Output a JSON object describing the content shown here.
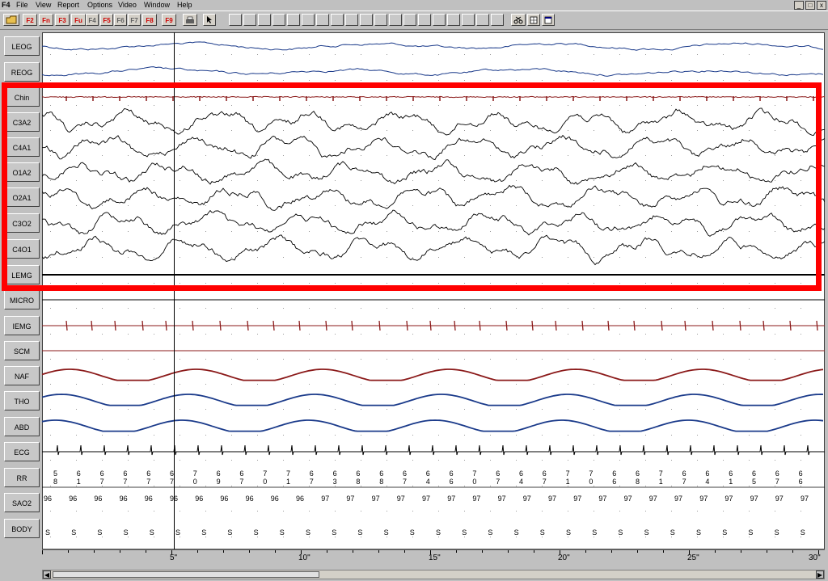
{
  "app": {
    "title": "F4"
  },
  "menu": [
    "File",
    "View",
    "Report",
    "Options",
    "Video",
    "Window",
    "Help"
  ],
  "window_controls": [
    "_",
    "□",
    "x"
  ],
  "toolbar": {
    "function_keys": [
      {
        "label": "F2",
        "color": "red"
      },
      {
        "label": "Fn",
        "color": "red"
      },
      {
        "label": "F3",
        "color": "red"
      },
      {
        "label": "Fu",
        "color": "red"
      },
      {
        "label": "F4",
        "color": "gray"
      },
      {
        "label": "F5",
        "color": "red"
      },
      {
        "label": "F6",
        "color": "gray"
      },
      {
        "label": "F7",
        "color": "gray"
      },
      {
        "label": "F8",
        "color": "red"
      },
      {
        "label": "F9",
        "color": "red"
      }
    ]
  },
  "channels": [
    {
      "name": "LEOG",
      "color": "#1a3a8a",
      "type": "eog"
    },
    {
      "name": "REOG",
      "color": "#1a3a8a",
      "type": "eog"
    },
    {
      "name": "Chin",
      "color": "#8b1a1a",
      "type": "chin"
    },
    {
      "name": "C3A2",
      "color": "#000000",
      "type": "eeg"
    },
    {
      "name": "C4A1",
      "color": "#000000",
      "type": "eeg"
    },
    {
      "name": "O1A2",
      "color": "#000000",
      "type": "eeg"
    },
    {
      "name": "O2A1",
      "color": "#000000",
      "type": "eeg"
    },
    {
      "name": "C3O2",
      "color": "#000000",
      "type": "eeg"
    },
    {
      "name": "C4O1",
      "color": "#000000",
      "type": "eeg"
    },
    {
      "name": "LEMG",
      "color": "#000000",
      "type": "flat"
    },
    {
      "name": "MICRO",
      "color": "#000000",
      "type": "flat"
    },
    {
      "name": "IEMG",
      "color": "#8b1a1a",
      "type": "spikes"
    },
    {
      "name": "SCM",
      "color": "#8b1a1a",
      "type": "flat"
    },
    {
      "name": "NAF",
      "color": "#8b1a1a",
      "type": "resp"
    },
    {
      "name": "THO",
      "color": "#1a3a8a",
      "type": "resp"
    },
    {
      "name": "ABD",
      "color": "#1a3a8a",
      "type": "resp"
    },
    {
      "name": "ECG",
      "color": "#000000",
      "type": "ecg"
    },
    {
      "name": "RR",
      "color": "#000000",
      "type": "numbers"
    },
    {
      "name": "SAO2",
      "color": "#000000",
      "type": "numbers"
    },
    {
      "name": "BODY",
      "color": "#000000",
      "type": "letters"
    }
  ],
  "rr_values": [
    "58",
    "61",
    "67",
    "67",
    "67",
    "67",
    "70",
    "69",
    "67",
    "70",
    "71",
    "67",
    "63",
    "68",
    "68",
    "67",
    "64",
    "66",
    "70",
    "67",
    "64",
    "67",
    "71",
    "70",
    "66",
    "68",
    "71",
    "67",
    "64",
    "61",
    "65",
    "67",
    "66"
  ],
  "sao2_values": [
    "96",
    "96",
    "96",
    "96",
    "96",
    "96",
    "96",
    "96",
    "96",
    "96",
    "96",
    "97",
    "97",
    "97",
    "97",
    "97",
    "97",
    "97",
    "97",
    "97",
    "97",
    "97",
    "97",
    "97",
    "97",
    "97",
    "97",
    "97",
    "97",
    "97",
    "97",
    "97"
  ],
  "body_values": [
    "S",
    "S",
    "S",
    "S",
    "S",
    "S",
    "S",
    "S",
    "S",
    "S",
    "S",
    "S",
    "S",
    "S",
    "S",
    "S",
    "S",
    "S",
    "S",
    "S",
    "S",
    "S",
    "S",
    "S",
    "S",
    "S",
    "S",
    "S",
    "S",
    "S",
    "S"
  ],
  "time_axis": {
    "ticks": [
      "5\"",
      "10\"",
      "15\"",
      "20\"",
      "25\"",
      "30\""
    ],
    "tick_seconds": [
      5,
      10,
      15,
      20,
      25,
      30
    ],
    "range_seconds": [
      0,
      30
    ]
  },
  "highlight": {
    "color": "#ff0000"
  }
}
